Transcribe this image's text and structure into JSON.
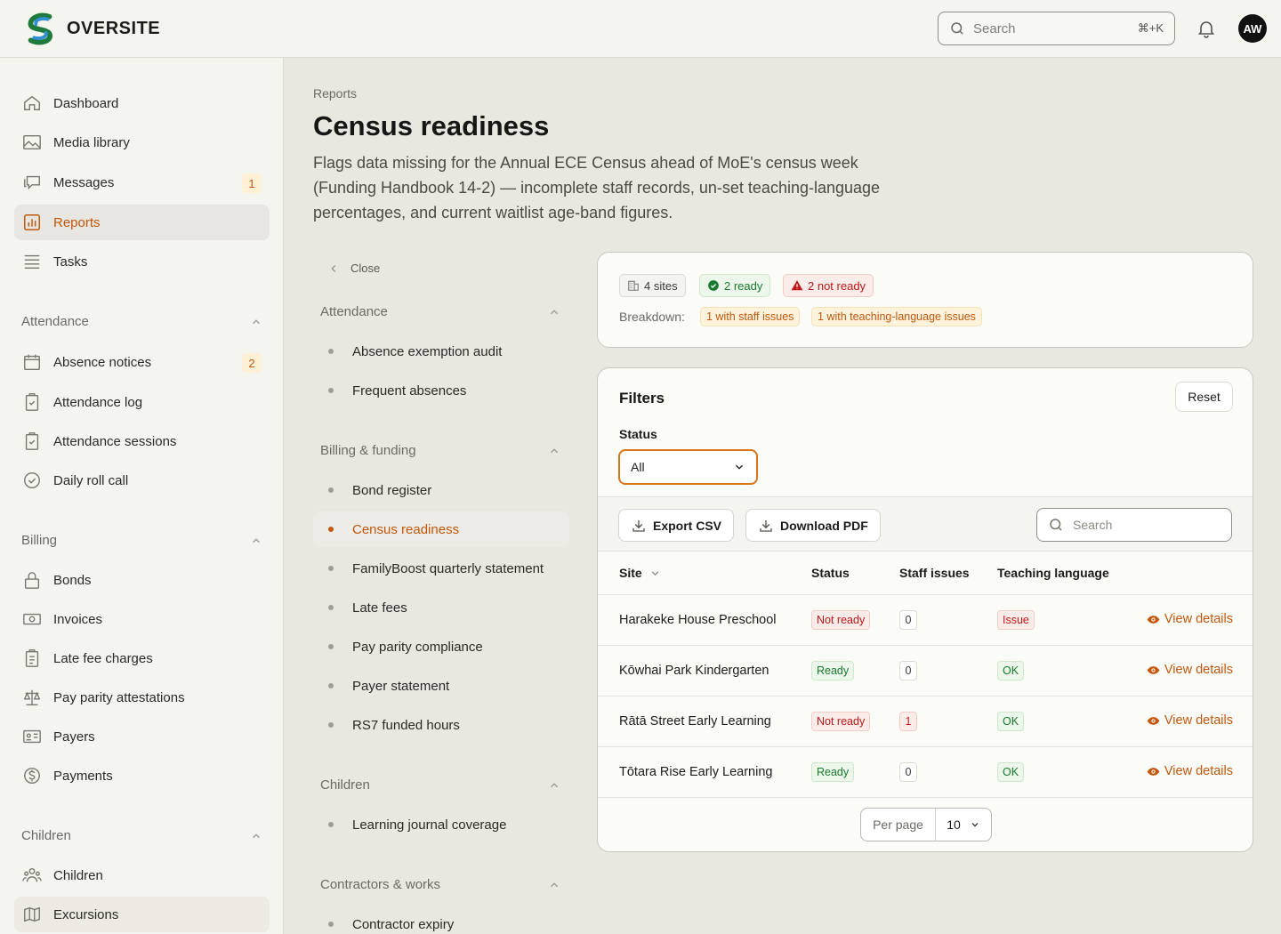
{
  "app": {
    "name": "OVERSITE"
  },
  "topbar": {
    "search_placeholder": "Search",
    "search_shortcut": "⌘+K",
    "avatar_initials": "AW"
  },
  "sidebar": {
    "top_items": [
      {
        "label": "Dashboard",
        "icon": "home-icon"
      },
      {
        "label": "Media library",
        "icon": "image-icon"
      },
      {
        "label": "Messages",
        "icon": "chat-icon",
        "badge": "1"
      },
      {
        "label": "Reports",
        "icon": "bar-chart-icon",
        "active": true
      },
      {
        "label": "Tasks",
        "icon": "list-icon"
      }
    ],
    "sections": [
      {
        "title": "Attendance",
        "items": [
          {
            "label": "Absence notices",
            "badge": "2"
          },
          {
            "label": "Attendance log"
          },
          {
            "label": "Attendance sessions"
          },
          {
            "label": "Daily roll call"
          }
        ]
      },
      {
        "title": "Billing",
        "items": [
          {
            "label": "Bonds"
          },
          {
            "label": "Invoices"
          },
          {
            "label": "Late fee charges"
          },
          {
            "label": "Pay parity attestations"
          },
          {
            "label": "Payers"
          },
          {
            "label": "Payments"
          }
        ]
      },
      {
        "title": "Children",
        "items": [
          {
            "label": "Children"
          },
          {
            "label": "Excursions"
          }
        ]
      }
    ]
  },
  "page": {
    "breadcrumb": "Reports",
    "title": "Census readiness",
    "description": "Flags data missing for the Annual ECE Census ahead of MoE's census week (Funding Handbook 14-2) — incomplete staff records, un-set teaching-language percentages, and current waitlist age-band figures."
  },
  "report_list": {
    "close_label": "Close",
    "sections": [
      {
        "title": "Attendance",
        "items": [
          "Absence exemption audit",
          "Frequent absences"
        ]
      },
      {
        "title": "Billing & funding",
        "items": [
          "Bond register",
          "Census readiness",
          "FamilyBoost quarterly statement",
          "Late fees",
          "Pay parity compliance",
          "Payer statement",
          "RS7 funded hours"
        ]
      },
      {
        "title": "Children",
        "items": [
          "Learning journal coverage"
        ]
      },
      {
        "title": "Contractors & works",
        "items": [
          "Contractor expiry"
        ]
      }
    ]
  },
  "summary": {
    "sites": "4 sites",
    "ready": "2 ready",
    "not_ready": "2 not ready",
    "breakdown_label": "Breakdown:",
    "breakdown_staff": "1 with staff issues",
    "breakdown_language": "1 with teaching-language issues"
  },
  "filters": {
    "title": "Filters",
    "reset": "Reset",
    "status_label": "Status",
    "status_value": "All",
    "export_csv": "Export CSV",
    "download_pdf": "Download PDF",
    "search_placeholder": "Search"
  },
  "table": {
    "headers": {
      "site": "Site",
      "status": "Status",
      "staff": "Staff issues",
      "language": "Teaching language"
    },
    "view_label": "View details",
    "rows": [
      {
        "site": "Harakeke House Preschool",
        "status": "Not ready",
        "staff": "0",
        "language": "Issue"
      },
      {
        "site": "Kōwhai Park Kindergarten",
        "status": "Ready",
        "staff": "0",
        "language": "OK"
      },
      {
        "site": "Rātā Street Early Learning",
        "status": "Not ready",
        "staff": "1",
        "language": "OK"
      },
      {
        "site": "Tōtara Rise Early Learning",
        "status": "Ready",
        "staff": "0",
        "language": "OK"
      }
    ]
  },
  "pager": {
    "label": "Per page",
    "value": "10"
  },
  "colors": {
    "accent": "#c2570c",
    "ready": "#187a2f",
    "not_ready": "#c01818"
  }
}
